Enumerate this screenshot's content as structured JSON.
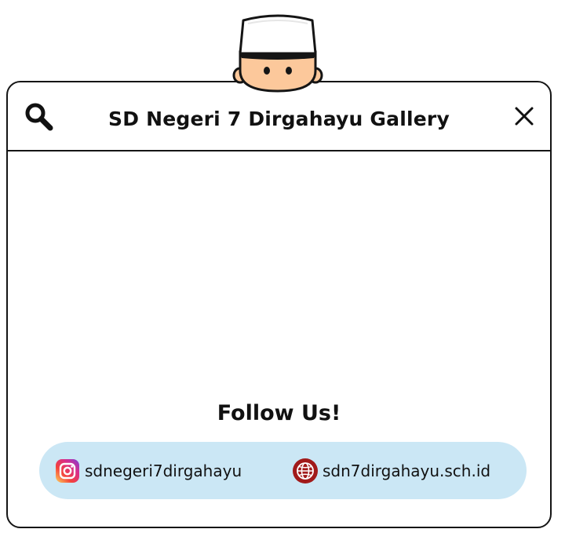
{
  "window": {
    "title": "SD Negeri 7 Dirgahayu Gallery"
  },
  "icons": {
    "search": "search-icon",
    "close": "close-icon",
    "instagram": "instagram-icon",
    "website": "globe-icon",
    "mascot": "kopiah-kid-mascot"
  },
  "follow": {
    "heading": "Follow Us!",
    "instagram_handle": "sdnegeri7dirgahayu",
    "website": "sdn7dirgahayu.sch.id"
  },
  "colors": {
    "social_pill_bg": "#cbe7f5",
    "web_icon": "#a11a1a",
    "border": "#151515"
  }
}
